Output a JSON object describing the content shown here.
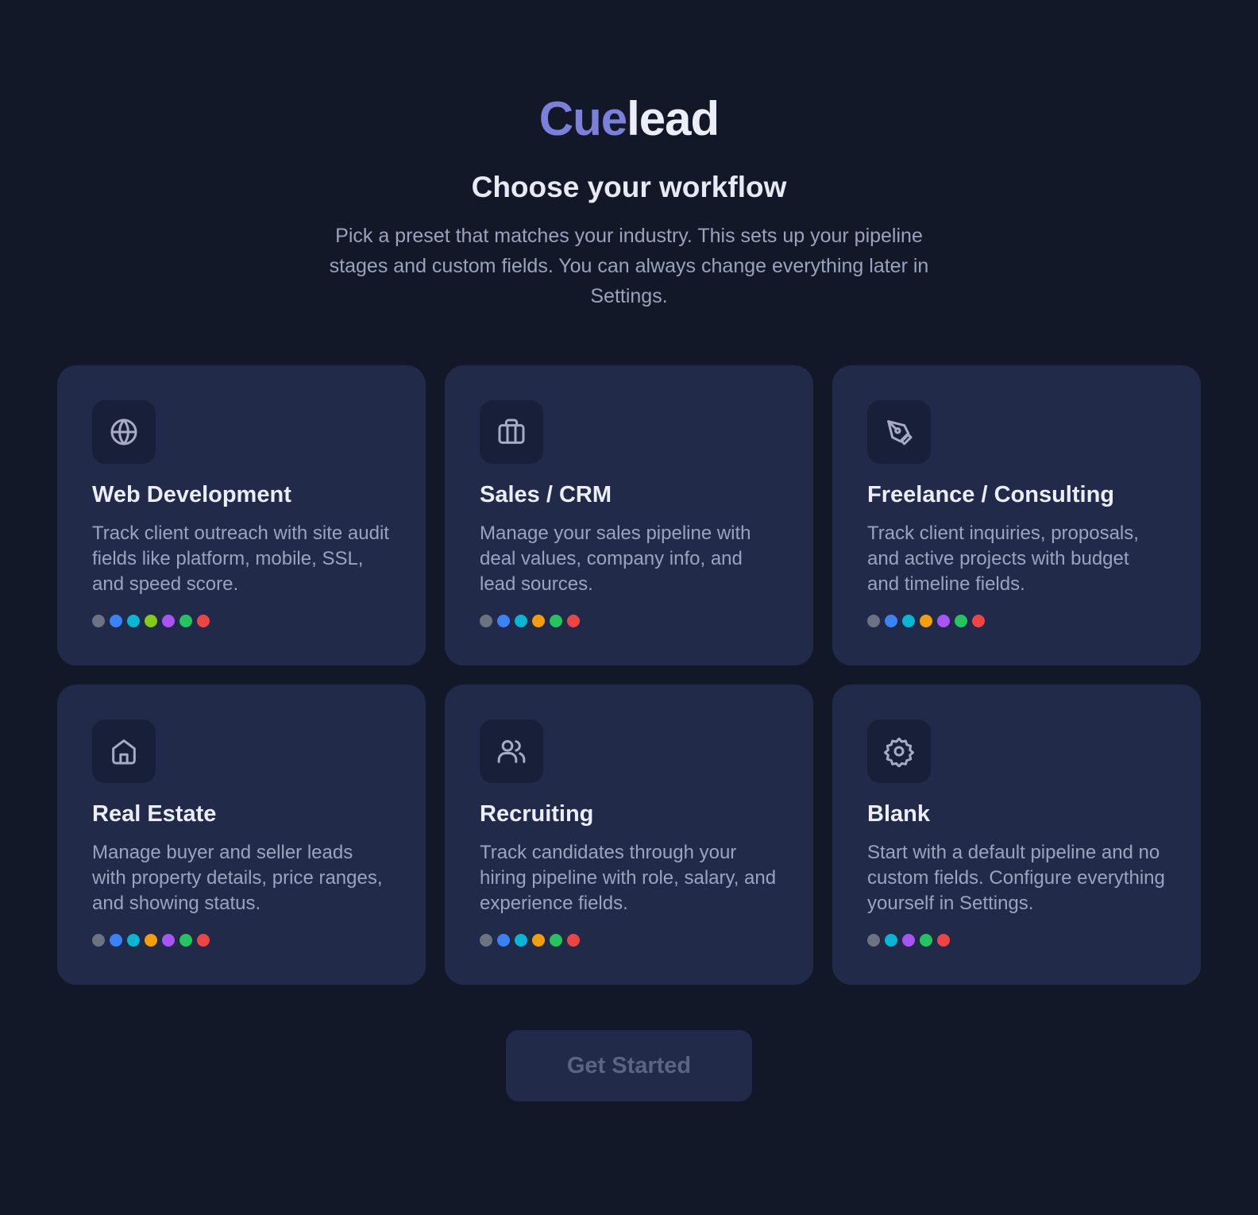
{
  "logo": {
    "accent": "Cue",
    "rest": "lead"
  },
  "title": "Choose your workflow",
  "subtitle": "Pick a preset that matches your industry. This sets up your pipeline stages and custom fields. You can always change everything later in Settings.",
  "colors": {
    "background": "#131829",
    "card": "#212a48",
    "brand_accent": "#7b80da"
  },
  "presets": [
    {
      "icon": "globe-icon",
      "title": "Web Development",
      "description": "Track client outreach with site audit fields like platform, mobile, SSL, and speed score.",
      "stage_colors": [
        "#6b7280",
        "#3b82f6",
        "#06b6d4",
        "#84cc16",
        "#a855f7",
        "#22c55e",
        "#ef4444"
      ]
    },
    {
      "icon": "briefcase-icon",
      "title": "Sales / CRM",
      "description": "Manage your sales pipeline with deal values, company info, and lead sources.",
      "stage_colors": [
        "#6b7280",
        "#3b82f6",
        "#06b6d4",
        "#f59e0b",
        "#22c55e",
        "#ef4444"
      ]
    },
    {
      "icon": "pen-tool-icon",
      "title": "Freelance / Consulting",
      "description": "Track client inquiries, proposals, and active projects with budget and timeline fields.",
      "stage_colors": [
        "#6b7280",
        "#3b82f6",
        "#06b6d4",
        "#f59e0b",
        "#a855f7",
        "#22c55e",
        "#ef4444"
      ]
    },
    {
      "icon": "home-icon",
      "title": "Real Estate",
      "description": "Manage buyer and seller leads with property details, price ranges, and showing status.",
      "stage_colors": [
        "#6b7280",
        "#3b82f6",
        "#06b6d4",
        "#f59e0b",
        "#a855f7",
        "#22c55e",
        "#ef4444"
      ]
    },
    {
      "icon": "users-icon",
      "title": "Recruiting",
      "description": "Track candidates through your hiring pipeline with role, salary, and experience fields.",
      "stage_colors": [
        "#6b7280",
        "#3b82f6",
        "#06b6d4",
        "#f59e0b",
        "#22c55e",
        "#ef4444"
      ]
    },
    {
      "icon": "gear-icon",
      "title": "Blank",
      "description": "Start with a default pipeline and no custom fields. Configure everything yourself in Settings.",
      "stage_colors": [
        "#6b7280",
        "#06b6d4",
        "#a855f7",
        "#22c55e",
        "#ef4444"
      ]
    }
  ],
  "cta": {
    "label": "Get Started",
    "state": "disabled"
  }
}
